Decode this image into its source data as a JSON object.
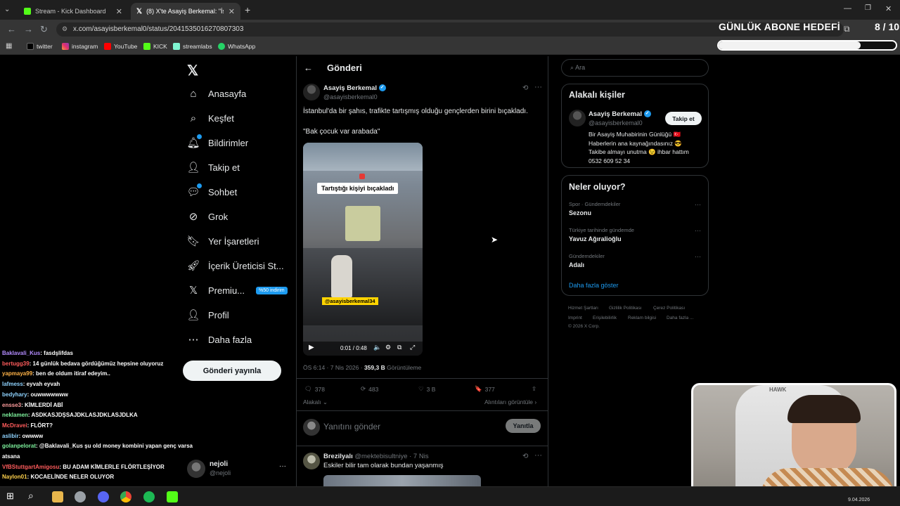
{
  "browser": {
    "tabs": [
      {
        "label": "Stream - Kick Dashboard",
        "active": false
      },
      {
        "label": "(8) X'te Asayiş Berkemal: \"İstanb",
        "active": true
      }
    ],
    "url": "x.com/asayisberkemal0/status/2041535016270807303",
    "bookmarks": [
      "twitter",
      "instagram",
      "YouTube",
      "KICK",
      "streamlabs",
      "WhatsApp"
    ]
  },
  "overlay": {
    "goal_title": "GÜNLÜK ABONE HEDEFİ",
    "goal_count": "8 / 10",
    "goal_progress": 0.8
  },
  "nav": {
    "items": [
      {
        "label": "Anasayfa",
        "icon": "home-icon"
      },
      {
        "label": "Keşfet",
        "icon": "search-icon"
      },
      {
        "label": "Bildirimler",
        "icon": "bell-icon"
      },
      {
        "label": "Takip et",
        "icon": "person-add-icon"
      },
      {
        "label": "Sohbet",
        "icon": "chat-icon"
      },
      {
        "label": "Grok",
        "icon": "grok-icon"
      },
      {
        "label": "Yer İşaretleri",
        "icon": "bookmark-icon"
      },
      {
        "label": "İçerik Üreticisi St...",
        "icon": "rocket-icon"
      },
      {
        "label": "Premiu...",
        "icon": "x-icon"
      },
      {
        "label": "Profil",
        "icon": "person-icon"
      },
      {
        "label": "Daha fazla",
        "icon": "more-icon"
      }
    ],
    "premium_badge": "%50 indirim",
    "post_button": "Gönderi yayınla",
    "account_name": "nejoli",
    "account_handle": "@nejoli"
  },
  "post": {
    "header": "Gönderi",
    "author": "Asayiş Berkemal",
    "handle": "@asayisberkemal0",
    "text": "İstanbul'da bir şahıs, trafikte tartışmış olduğu gençlerden birini bıçakladı.",
    "quote": "\"Bak çocuk var arabada\"",
    "video_caption": "Tartıştığı kişiyi bıçakladı",
    "video_watermark": "@asayisberkemal34",
    "video_time": "0:01 / 0:48",
    "time_prefix": "ÖS 6:14 · 7 Nis 2026 ·",
    "views": "359,3 B",
    "views_label": "Görüntüleme",
    "replies": "378",
    "reposts": "483",
    "likes": "3 B",
    "bookmarks": "377",
    "sort_label": "Alakalı",
    "quotes_link": "Alıntıları görüntüle",
    "reply_placeholder": "Yanıtını gönder",
    "reply_button": "Yanıtla"
  },
  "reply": {
    "author": "Brezilyalı",
    "handle": "@mektebisultniye",
    "time": "· 7 Nis",
    "text": "Eskiler bilir tam olarak bundan yaşanmış"
  },
  "sidebar": {
    "search_placeholder": "Ara",
    "related_title": "Alakalı kişiler",
    "related_name": "Asayiş Berkemal",
    "related_handle": "@asayisberkemal0",
    "follow_button": "Takip et",
    "related_bio": [
      "Bir Asayiş Muhabirinin Günlüğü 🇹🇷",
      "Haberlerin ana kaynağındasınız 😎",
      "Takibe almayı unutma 😉 ihbar hattım",
      "0532 609 52 34"
    ],
    "trends_title": "Neler oluyor?",
    "trends": [
      {
        "sub": "Spor · Gündemdekiler",
        "title": "Sezonu"
      },
      {
        "sub": "Türkiye tarihinde gündemde",
        "title": "Yavuz Ağıralioğlu"
      },
      {
        "sub": "Gündemdekiler",
        "title": "Adalı"
      }
    ],
    "show_more": "Daha fazla göster",
    "footer": [
      "Hizmet Şartları",
      "Gizlilik Politikası",
      "Çerez Politikası",
      "Imprint",
      "Erişilebilirlik",
      "Reklam bilgisi",
      "Daha fazla ...",
      "© 2026 X Corp."
    ]
  },
  "chat": [
    {
      "user": "Baklavali_Kus",
      "color": "#b48cff",
      "text": ": fasdşlifdas"
    },
    {
      "user": "bertugg39",
      "color": "#ff5c5c",
      "text": ": 14 günlük bedava gördüğümüz hepsine oluyoruz"
    },
    {
      "user": "yapmaya99",
      "color": "#ffb347",
      "text": ": ben de oldum itiraf edeyim.."
    },
    {
      "user": "lafmess",
      "color": "#8fd3ff",
      "text": ": eyvah eyvah"
    },
    {
      "user": "bedyhary",
      "color": "#8fd3ff",
      "text": ": ouwwwwwww"
    },
    {
      "user": "ensse3",
      "color": "#ff9d9d",
      "text": ": KİMLERDİ ABİ"
    },
    {
      "user": "neklamen",
      "color": "#7ef29d",
      "text": ": ASDKASJDŞSAJDKLASJDKLASJDLKA"
    },
    {
      "user": "McDravei",
      "color": "#ff5c5c",
      "text": ": FLÖRT?"
    },
    {
      "user": "aslibir",
      "color": "#8fd3ff",
      "text": ": owwww"
    },
    {
      "user": "golanpelorat",
      "color": "#7ef29d",
      "text": ": @Baklavali_Kus şu old money kombini yapan genç varsa"
    },
    {
      "user": "",
      "color": "#ffffff",
      "text": "atsana"
    },
    {
      "user": "VfBStuttgartAmigosu",
      "color": "#ff5c5c",
      "text": ": BU ADAM KİMLERLE FLÖRTLEŞİYOR"
    },
    {
      "user": "Naylon01",
      "color": "#ffd24d",
      "text": ": KOCAELİNDE NELER OLUYOR"
    }
  ],
  "taskbar": {
    "date": "9.04.2026"
  }
}
